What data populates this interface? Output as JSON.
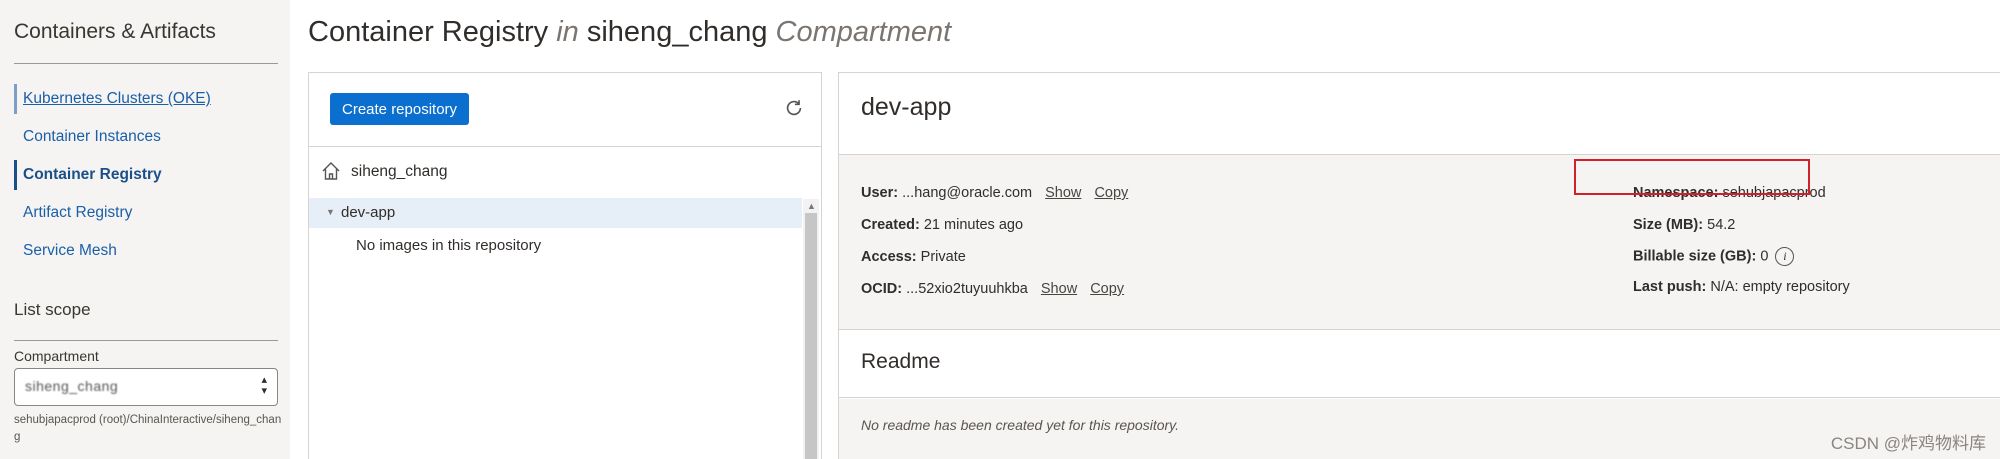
{
  "sidebar": {
    "title": "Containers & Artifacts",
    "items": [
      {
        "label": "Kubernetes Clusters (OKE)"
      },
      {
        "label": "Container Instances"
      },
      {
        "label": "Container Registry"
      },
      {
        "label": "Artifact Registry"
      },
      {
        "label": "Service Mesh"
      }
    ],
    "scope_title": "List scope",
    "compartment_label": "Compartment",
    "compartment_value": "siheng_chang",
    "compartment_path": "sehubjapacprod (root)/ChinaInteractive/siheng_chang"
  },
  "header": {
    "title_main": "Container Registry",
    "title_in": "in",
    "title_compartment": "siheng_chang",
    "title_suffix": "Compartment"
  },
  "tree": {
    "create_button": "Create repository",
    "root_label": "siheng_chang",
    "repo_label": "dev-app",
    "empty_text": "No images in this repository"
  },
  "detail": {
    "repo_name": "dev-app",
    "user_label": "User:",
    "user_value": "...hang@oracle.com",
    "show_label": "Show",
    "copy_label": "Copy",
    "created_label": "Created:",
    "created_value": "21 minutes ago",
    "access_label": "Access:",
    "access_value": "Private",
    "ocid_label": "OCID:",
    "ocid_value": "...52xio2tuyuuhkba",
    "namespace_label": "Namespace:",
    "namespace_value": "sehubjapacprod",
    "size_label": "Size (MB):",
    "size_value": "54.2",
    "billable_label": "Billable size (GB):",
    "billable_value": "0",
    "lastpush_label": "Last push:",
    "lastpush_value": "N/A: empty repository",
    "readme_title": "Readme",
    "readme_empty": "No readme has been created yet for this repository."
  },
  "watermark": "CSDN @炸鸡物料库",
  "colors": {
    "accent": "#0b6fcf",
    "link": "#1a5fa8",
    "highlight_box": "#d0202a",
    "sidebar_bg": "#f5f4f2"
  }
}
